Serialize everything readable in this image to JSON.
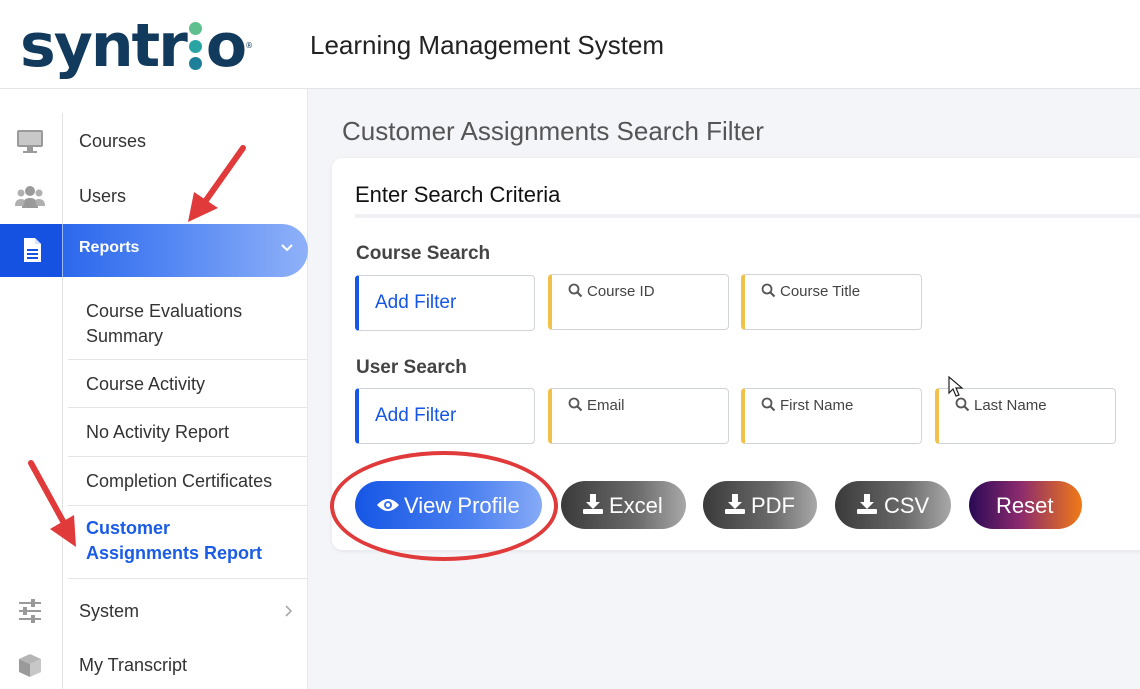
{
  "header": {
    "logo_text": "syntrio",
    "app_title": "Learning Management System"
  },
  "sidebar": {
    "items": [
      {
        "label": "Courses",
        "icon": "monitor-icon"
      },
      {
        "label": "Users",
        "icon": "users-icon"
      },
      {
        "label": "Reports",
        "icon": "document-icon",
        "expanded": true
      },
      {
        "label": "System",
        "icon": "sliders-icon"
      },
      {
        "label": "My Transcript",
        "icon": "cube-icon"
      }
    ],
    "reports_submenu": [
      {
        "label": "Course Evaluations Summary"
      },
      {
        "label": "Course Activity"
      },
      {
        "label": "No Activity Report"
      },
      {
        "label": "Completion Certificates"
      },
      {
        "label": "Customer Assignments Report",
        "active": true
      }
    ]
  },
  "main": {
    "page_title": "Customer Assignments Search Filter",
    "card_title": "Enter Search Criteria",
    "course_search": {
      "label": "Course Search",
      "add_filter": "Add Filter",
      "fields": [
        {
          "placeholder": "Course ID"
        },
        {
          "placeholder": "Course Title"
        }
      ]
    },
    "user_search": {
      "label": "User Search",
      "add_filter": "Add Filter",
      "fields": [
        {
          "placeholder": "Email"
        },
        {
          "placeholder": "First Name"
        },
        {
          "placeholder": "Last Name"
        }
      ]
    },
    "buttons": {
      "view_profile": "View Profile",
      "excel": "Excel",
      "pdf": "PDF",
      "csv": "CSV",
      "reset": "Reset"
    }
  },
  "colors": {
    "primary_blue": "#1556e4",
    "field_accent": "#f2c14a",
    "annotation_red": "#e03a3a",
    "logo_navy": "#123a5c"
  }
}
